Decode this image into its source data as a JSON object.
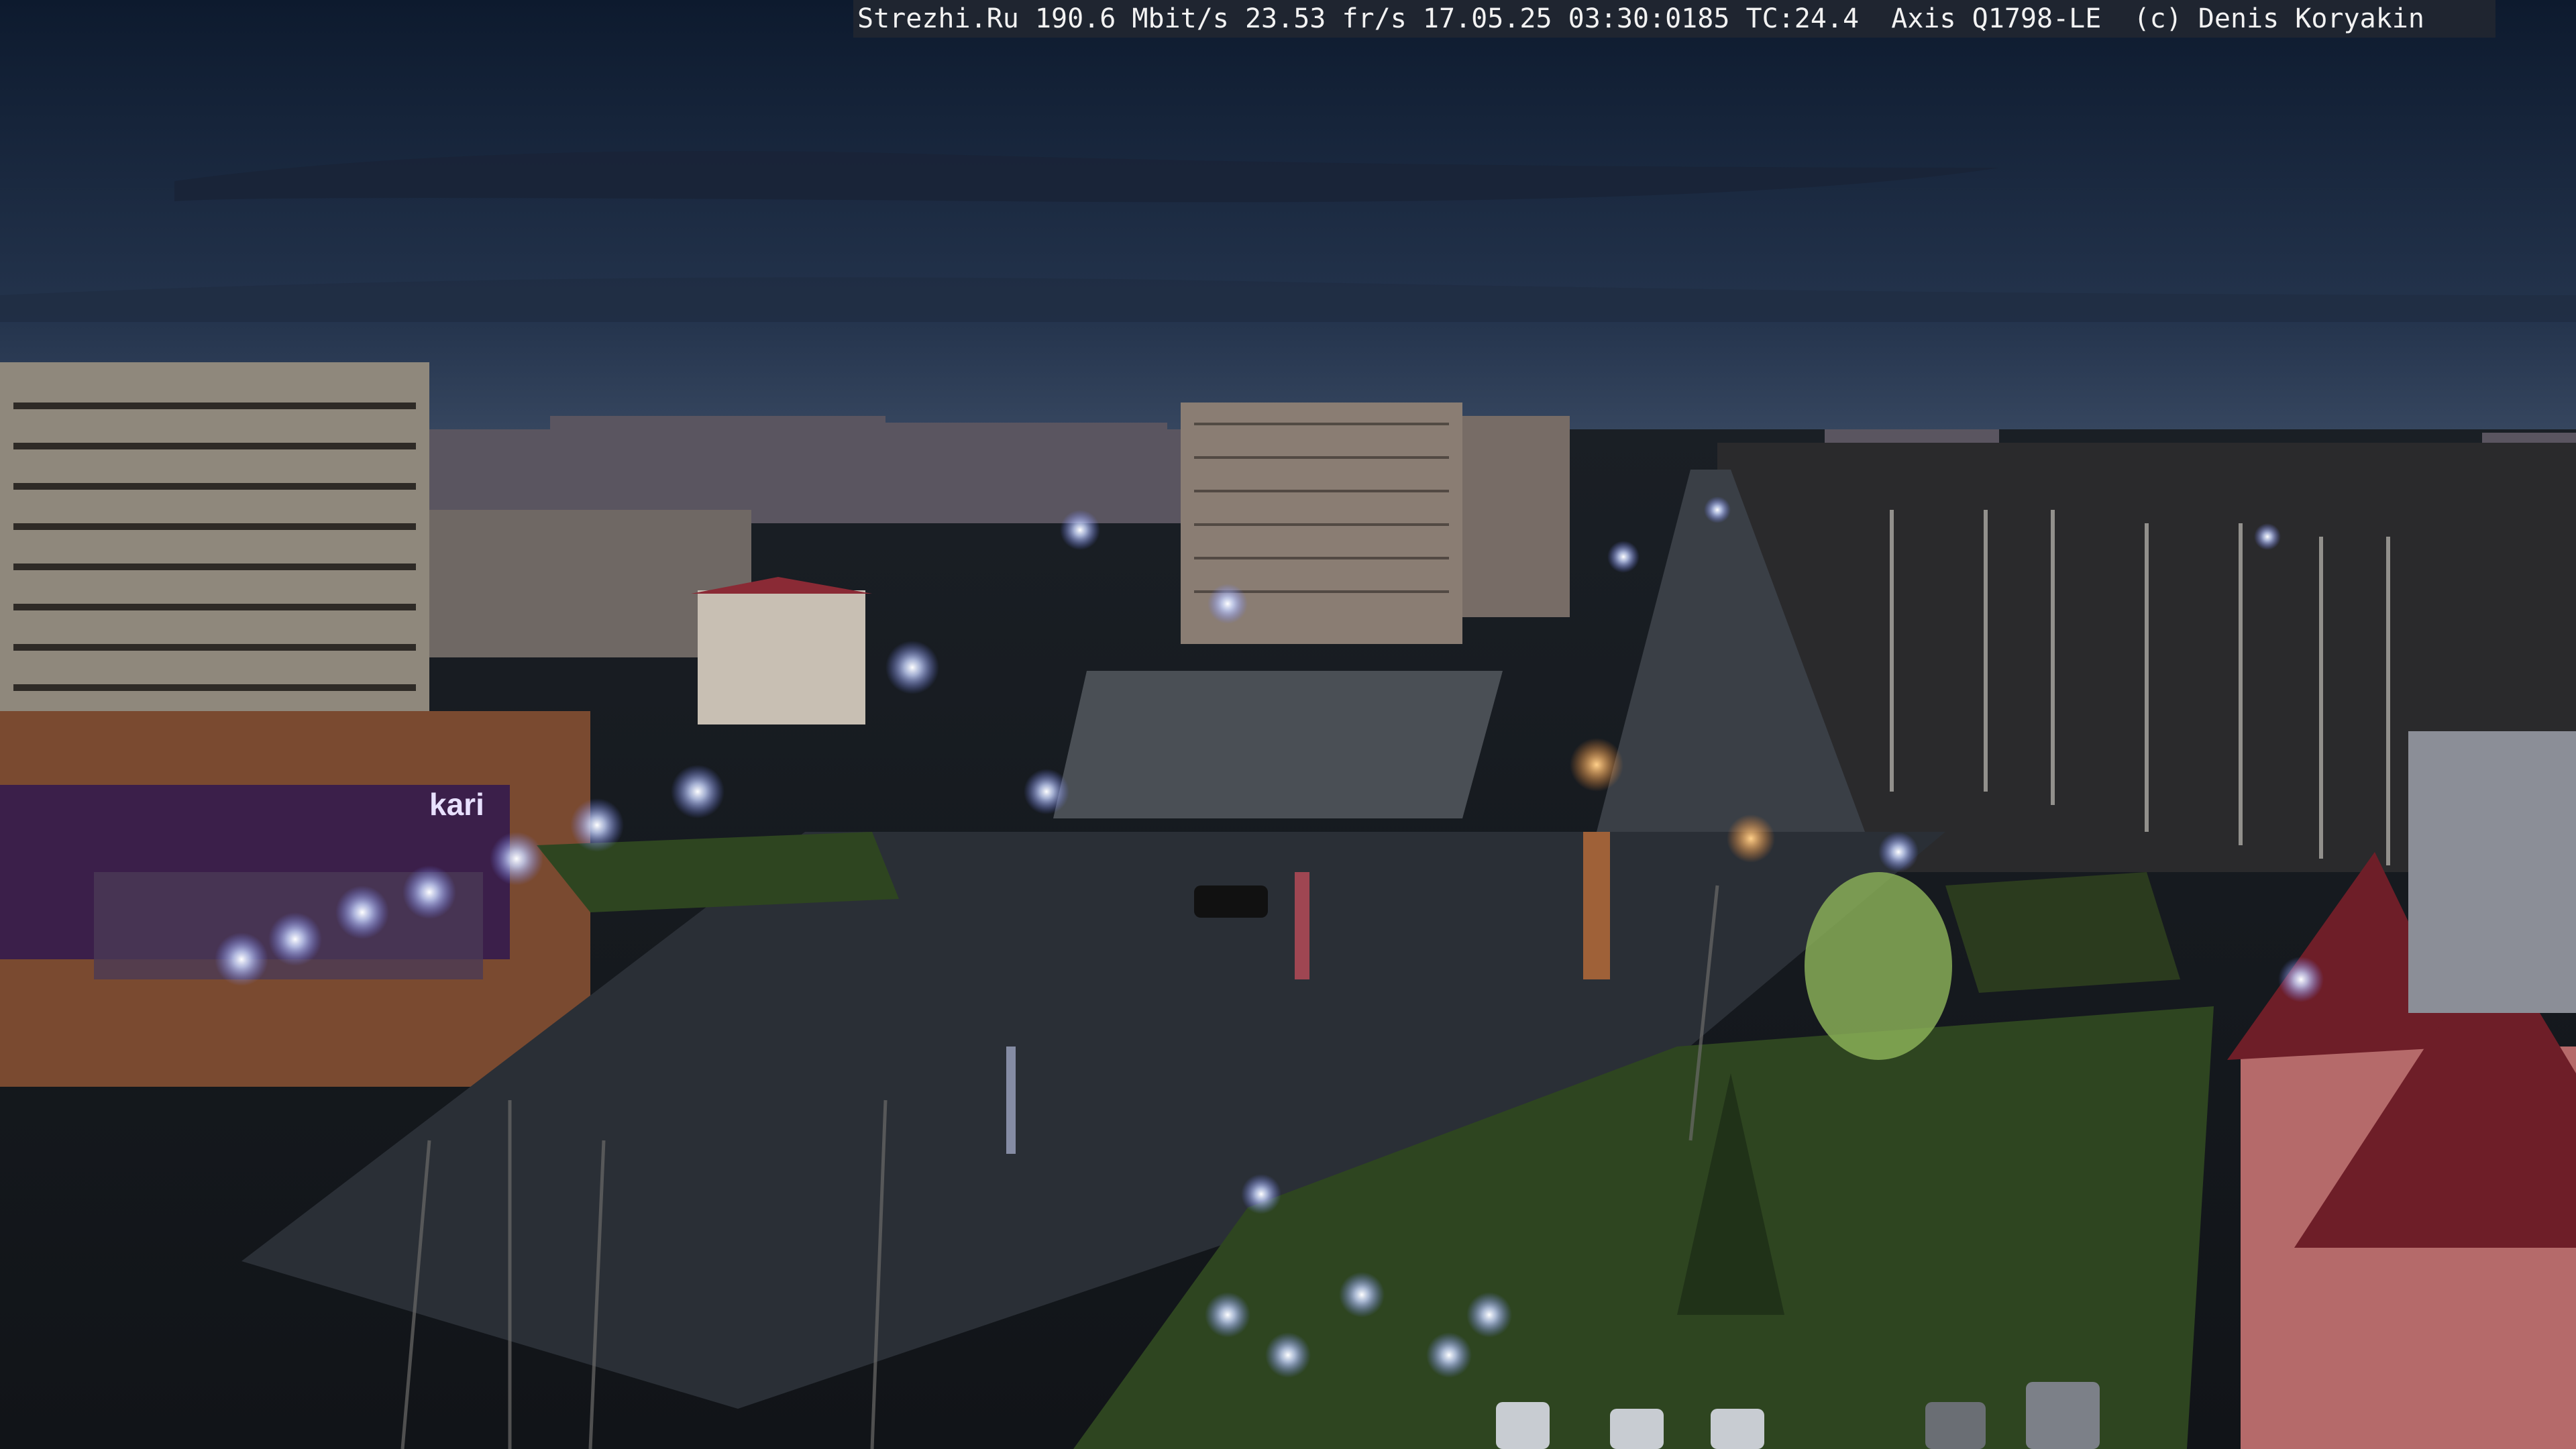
{
  "camera_overlay": {
    "text": "Strezhi.Ru 190.6 Mbit/s 23.53 fr/s 17.05.25 03:30:0185 TC:24.4  Axis Q1798-LE  (c) Denis Koryakin"
  },
  "signs": {
    "left_store_logo": "kari"
  },
  "colors": {
    "sky_top": "#0d1a2e",
    "sky_horizon": "#3a4a63",
    "street_light": "#c9d6ff",
    "storefront": "#3b1f4a",
    "grass": "#2e4520",
    "road_wet": "#2a2f36"
  }
}
